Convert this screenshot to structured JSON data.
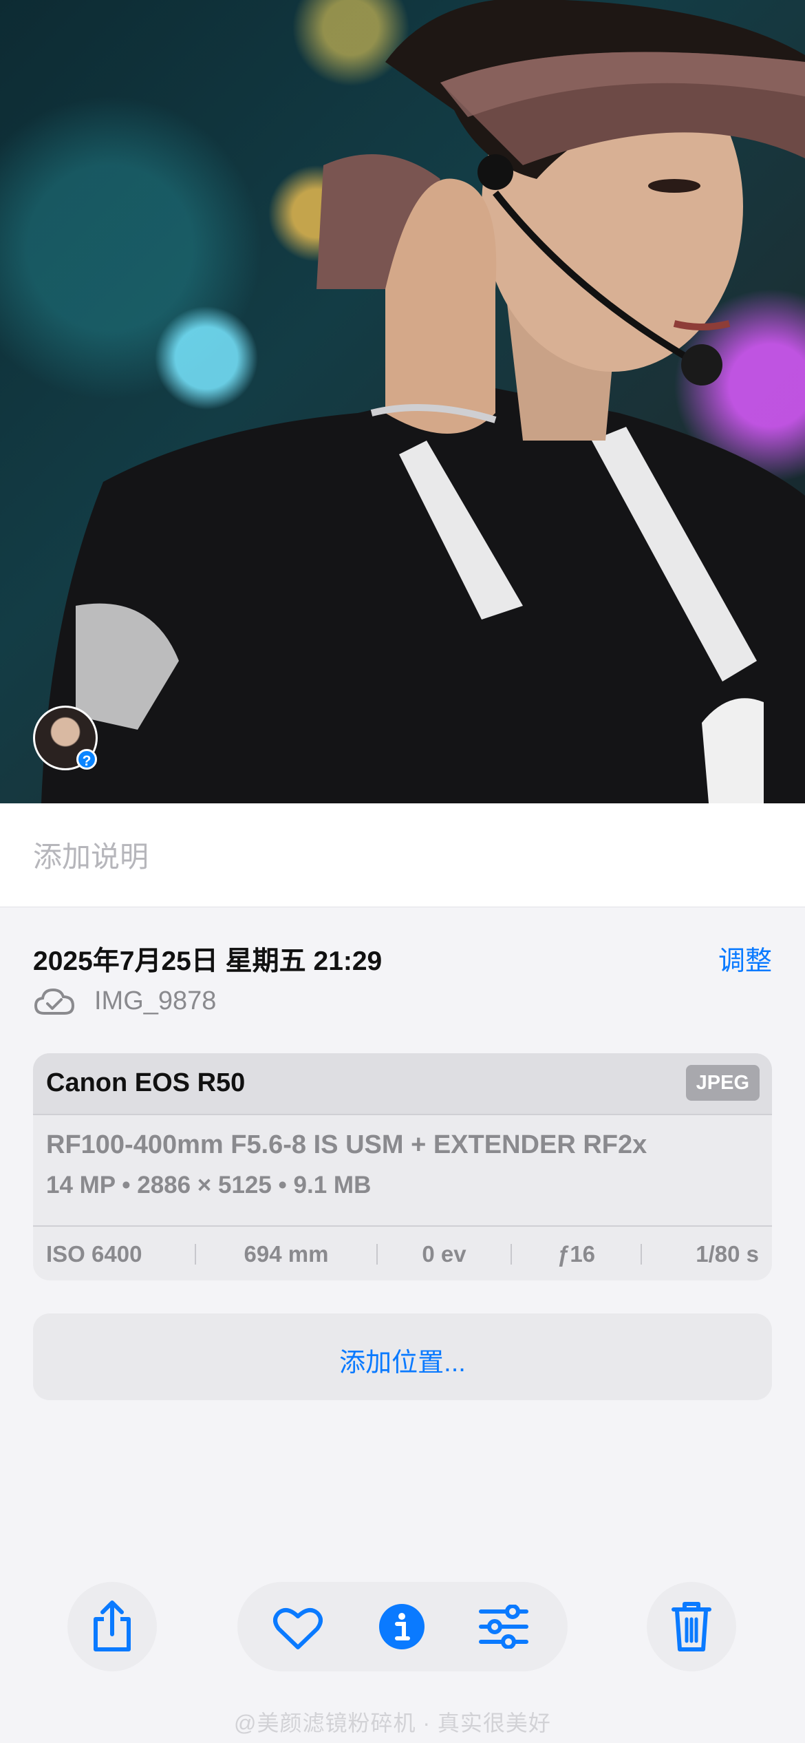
{
  "caption": {
    "placeholder": "添加说明"
  },
  "info": {
    "datetime": "2025年7月25日 星期五 21:29",
    "adjust_label": "调整",
    "filename": "IMG_9878"
  },
  "camera": {
    "model": "Canon EOS R50",
    "format_badge": "JPEG",
    "lens": "RF100-400mm F5.6-8 IS USM + EXTENDER RF2x",
    "specs": "14 MP • 2886 × 5125 • 9.1 MB",
    "exif": {
      "iso": "ISO 6400",
      "focal": "694 mm",
      "ev": "0 ev",
      "aperture": "ƒ16",
      "shutter": "1/80 s"
    }
  },
  "location": {
    "add_label": "添加位置..."
  },
  "toolbar": {
    "icons": [
      "share-icon",
      "heart-icon",
      "info-icon",
      "adjust-icon",
      "trash-icon"
    ]
  },
  "avatar_badge": "?",
  "watermark": "@美颜滤镜粉碎机 · 真实很美好",
  "colors": {
    "accent": "#0a7aff",
    "background": "#f4f4f7"
  }
}
